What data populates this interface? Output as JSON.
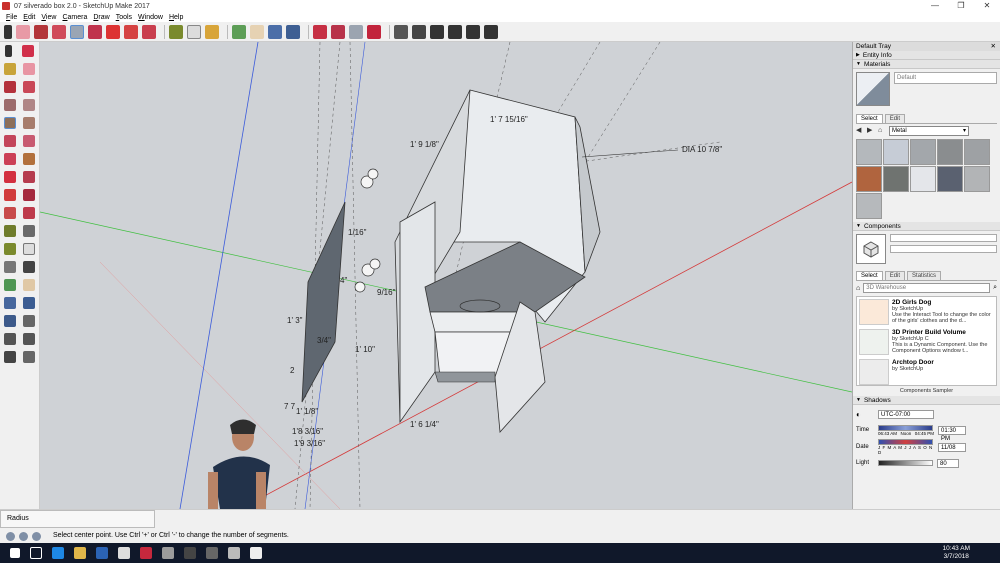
{
  "window": {
    "title": "07 silverado box 2.0 - SketchUp Make 2017",
    "controls": [
      "—",
      "❐",
      "✕"
    ]
  },
  "menu": [
    "File",
    "Edit",
    "View",
    "Camera",
    "Draw",
    "Tools",
    "Window",
    "Help"
  ],
  "viewport": {
    "dimensions": [
      "1' 7 15/16\"",
      "1' 9 1/8\"",
      "DIA 10 7/8\"",
      "1/16\"",
      "9/16\"",
      "1' 10\"",
      "1' 3\"",
      "3/4\"",
      "1' 1/8\"",
      "1'8 3/16\"",
      "1'9 3/16\"",
      "1' 6 1/4\"",
      "7 7",
      "2",
      "4\""
    ]
  },
  "tray": {
    "title": "Default Tray",
    "entity_info": "Entity Info",
    "materials": {
      "header": "Materials",
      "name": "Default",
      "tabs": [
        "Select",
        "Edit"
      ],
      "library": "Metal",
      "swatch_colors": [
        "#b4b8bc",
        "#c6ccd6",
        "#a3a7ab",
        "#8a8d8f",
        "#9ea1a4",
        "#b0643e",
        "#6f7370",
        "#e4e6ea",
        "#5a6170",
        "#b2b4b6",
        "#b6b9bc"
      ]
    },
    "components": {
      "header": "Components",
      "tabs": [
        "Select",
        "Edit",
        "Statistics"
      ],
      "search_placeholder": "3D Warehouse",
      "items": [
        {
          "name": "2D Girls Dog",
          "by": "by SketchUp",
          "desc": "Use the Interact Tool to change the color of the girls' clothes and the d..."
        },
        {
          "name": "3D Printer Build Volume",
          "by": "by SketchUp C",
          "desc": "This is a Dynamic Component. Use the Component Options window t..."
        },
        {
          "name": "Archtop Door",
          "by": "by SketchUp",
          "desc": ""
        }
      ],
      "sampler": "Components Sampler"
    },
    "shadows": {
      "header": "Shadows",
      "timezone": "UTC-07:00",
      "time_label": "Time",
      "time_start": "06:43 AM",
      "time_noon": "Noon",
      "time_end": "04:45 PM",
      "time_value": "01:30 PM",
      "date_label": "Date",
      "months": "J F M A M J J A S O N D",
      "date_value": "11/08",
      "light_label": "Light",
      "light_value": "80"
    }
  },
  "status": {
    "measure_label": "Radius",
    "hint": "Select center point. Use Ctrl '+' or Ctrl '-' to change the number of segments."
  },
  "taskbar": {
    "time": "10:43 AM",
    "date": "3/7/2018"
  }
}
